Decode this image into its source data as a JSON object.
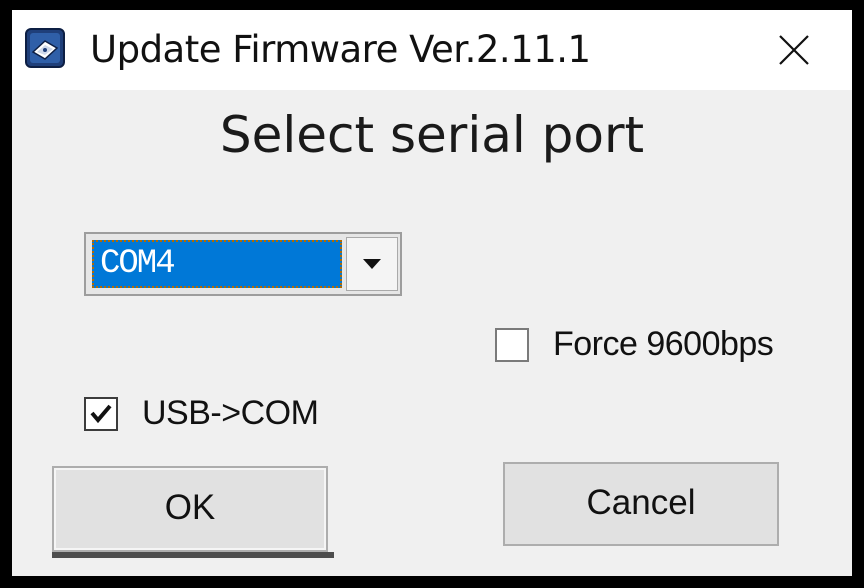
{
  "window": {
    "title": "Update Firmware Ver.2.11.1",
    "icon": "modem-icon",
    "close_icon": "close-icon"
  },
  "dialog": {
    "heading": "Select serial port",
    "port_select": {
      "selected": "COM4",
      "dropdown_icon": "chevron-down-icon"
    },
    "force_9600": {
      "label": "Force 9600bps",
      "checked": false
    },
    "usb_com": {
      "label": "USB->COM",
      "checked": true
    },
    "ok_label": "OK",
    "cancel_label": "Cancel"
  },
  "colors": {
    "selection_blue": "#0078d7",
    "dialog_bg": "#f0f0f0",
    "titlebar_bg": "#ffffff",
    "app_icon_blue": "#1f3f7a"
  }
}
